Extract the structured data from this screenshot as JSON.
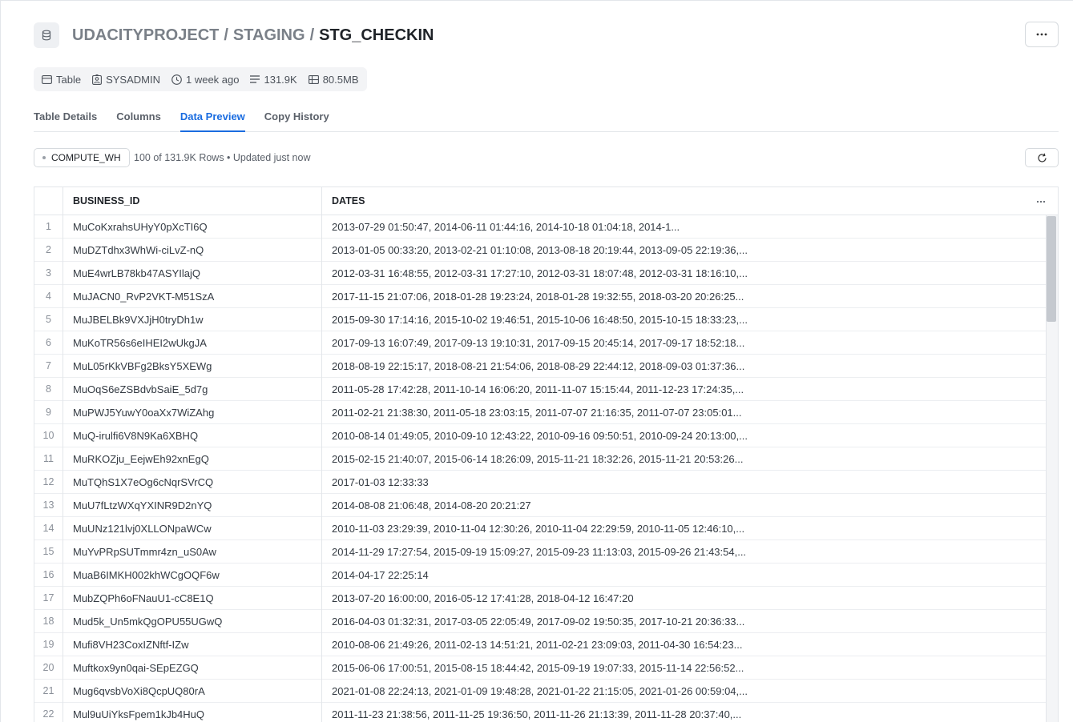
{
  "breadcrumb": {
    "database": "UDACITYPROJECT",
    "schema": "STAGING",
    "table": "STG_CHECKIN",
    "separator": "/"
  },
  "meta": {
    "type": "Table",
    "owner": "SYSADMIN",
    "modified": "1 week ago",
    "rows": "131.9K",
    "size": "80.5MB"
  },
  "tabs": [
    "Table Details",
    "Columns",
    "Data Preview",
    "Copy History"
  ],
  "active_tab": "Data Preview",
  "warehouse": {
    "name": "COMPUTE_WH",
    "rows_info": "100 of 131.9K Rows • Updated just now"
  },
  "icons": {
    "header": "database-icon",
    "more": "ellipsis-icon",
    "refresh": "refresh-icon"
  },
  "colors": {
    "accent": "#1a6ce0",
    "muted_text": "#7a8088",
    "chip_bg": "#f3f4f6"
  },
  "table": {
    "columns": [
      "BUSINESS_ID",
      "DATES"
    ],
    "rows": [
      {
        "n": "1",
        "business_id": "MuCoKxrahsUHyY0pXcTI6Q",
        "dates": "2013-07-29 01:50:47, 2014-06-11 01:44:16, 2014-10-18 01:04:18, 2014-1..."
      },
      {
        "n": "2",
        "business_id": "MuDZTdhx3WhWi-ciLvZ-nQ",
        "dates": "2013-01-05 00:33:20, 2013-02-21 01:10:08, 2013-08-18 20:19:44, 2013-09-05 22:19:36,..."
      },
      {
        "n": "3",
        "business_id": "MuE4wrLB78kb47ASYIlajQ",
        "dates": "2012-03-31 16:48:55, 2012-03-31 17:27:10, 2012-03-31 18:07:48, 2012-03-31 18:16:10,..."
      },
      {
        "n": "4",
        "business_id": "MuJACN0_RvP2VKT-M51SzA",
        "dates": "2017-11-15 21:07:06, 2018-01-28 19:23:24, 2018-01-28 19:32:55, 2018-03-20 20:26:25..."
      },
      {
        "n": "5",
        "business_id": "MuJBELBk9VXJjH0tryDh1w",
        "dates": "2015-09-30 17:14:16, 2015-10-02 19:46:51, 2015-10-06 16:48:50, 2015-10-15 18:33:23,..."
      },
      {
        "n": "6",
        "business_id": "MuKoTR56s6eIHEI2wUkgJA",
        "dates": "2017-09-13 16:07:49, 2017-09-13 19:10:31, 2017-09-15 20:45:14, 2017-09-17 18:52:18..."
      },
      {
        "n": "7",
        "business_id": "MuL05rKkVBFg2BksY5XEWg",
        "dates": "2018-08-19 22:15:17, 2018-08-21 21:54:06, 2018-08-29 22:44:12, 2018-09-03 01:37:36..."
      },
      {
        "n": "8",
        "business_id": "MuOqS6eZSBdvbSaiE_5d7g",
        "dates": "2011-05-28 17:42:28, 2011-10-14 16:06:20, 2011-11-07 15:15:44, 2011-12-23 17:24:35,..."
      },
      {
        "n": "9",
        "business_id": "MuPWJ5YuwY0oaXx7WiZAhg",
        "dates": "2011-02-21 21:38:30, 2011-05-18 23:03:15, 2011-07-07 21:16:35, 2011-07-07 23:05:01..."
      },
      {
        "n": "10",
        "business_id": "MuQ-irulfi6V8N9Ka6XBHQ",
        "dates": "2010-08-14 01:49:05, 2010-09-10 12:43:22, 2010-09-16 09:50:51, 2010-09-24 20:13:00,..."
      },
      {
        "n": "11",
        "business_id": "MuRKOZju_EejwEh92xnEgQ",
        "dates": "2015-02-15 21:40:07, 2015-06-14 18:26:09, 2015-11-21 18:32:26, 2015-11-21 20:53:26..."
      },
      {
        "n": "12",
        "business_id": "MuTQhS1X7eOg6cNqrSVrCQ",
        "dates": "2017-01-03 12:33:33"
      },
      {
        "n": "13",
        "business_id": "MuU7fLtzWXqYXINR9D2nYQ",
        "dates": "2014-08-08 21:06:48, 2014-08-20 20:21:27"
      },
      {
        "n": "14",
        "business_id": "MuUNz121lvj0XLLONpaWCw",
        "dates": "2010-11-03 23:29:39, 2010-11-04 12:30:26, 2010-11-04 22:29:59, 2010-11-05 12:46:10,..."
      },
      {
        "n": "15",
        "business_id": "MuYvPRpSUTmmr4zn_uS0Aw",
        "dates": "2014-11-29 17:27:54, 2015-09-19 15:09:27, 2015-09-23 11:13:03, 2015-09-26 21:43:54,..."
      },
      {
        "n": "16",
        "business_id": "MuaB6IMKH002khWCgOQF6w",
        "dates": "2014-04-17 22:25:14"
      },
      {
        "n": "17",
        "business_id": "MubZQPh6oFNauU1-cC8E1Q",
        "dates": "2013-07-20 16:00:00, 2016-05-12 17:41:28, 2018-04-12 16:47:20"
      },
      {
        "n": "18",
        "business_id": "Mud5k_Un5mkQgOPU55UGwQ",
        "dates": "2016-04-03 01:32:31, 2017-03-05 22:05:49, 2017-09-02 19:50:35, 2017-10-21 20:36:33..."
      },
      {
        "n": "19",
        "business_id": "Mufi8VH23CoxIZNftf-IZw",
        "dates": "2010-08-06 21:49:26, 2011-02-13 14:51:21, 2011-02-21 23:09:03, 2011-04-30 16:54:23..."
      },
      {
        "n": "20",
        "business_id": "Muftkox9yn0qai-SEpEZGQ",
        "dates": "2015-06-06 17:00:51, 2015-08-15 18:44:42, 2015-09-19 19:07:33, 2015-11-14 22:56:52..."
      },
      {
        "n": "21",
        "business_id": "Mug6qvsbVoXi8QcpUQ80rA",
        "dates": "2021-01-08 22:24:13, 2021-01-09 19:48:28, 2021-01-22 21:15:05, 2021-01-26 00:59:04,..."
      },
      {
        "n": "22",
        "business_id": "Mul9uUiYksFpem1kJb4HuQ",
        "dates": "2011-11-23 21:38:56, 2011-11-25 19:36:50, 2011-11-26 21:13:39, 2011-11-28 20:37:40,..."
      }
    ]
  }
}
